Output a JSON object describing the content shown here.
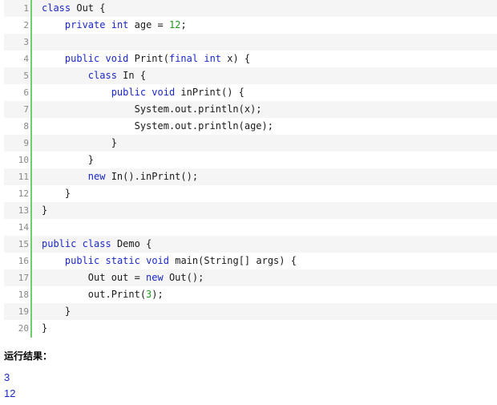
{
  "code": {
    "lines": [
      {
        "num": "1",
        "tokens": [
          {
            "t": "class",
            "k": "kw"
          },
          {
            "t": " Out {",
            "k": "plain"
          }
        ]
      },
      {
        "num": "2",
        "tokens": [
          {
            "t": "    ",
            "k": "plain"
          },
          {
            "t": "private",
            "k": "kw"
          },
          {
            "t": " ",
            "k": "plain"
          },
          {
            "t": "int",
            "k": "kw"
          },
          {
            "t": " age = ",
            "k": "plain"
          },
          {
            "t": "12",
            "k": "num"
          },
          {
            "t": ";",
            "k": "plain"
          }
        ]
      },
      {
        "num": "3",
        "tokens": []
      },
      {
        "num": "4",
        "tokens": [
          {
            "t": "    ",
            "k": "plain"
          },
          {
            "t": "public",
            "k": "kw"
          },
          {
            "t": " ",
            "k": "plain"
          },
          {
            "t": "void",
            "k": "kw"
          },
          {
            "t": " Print(",
            "k": "plain"
          },
          {
            "t": "final",
            "k": "kw"
          },
          {
            "t": " ",
            "k": "plain"
          },
          {
            "t": "int",
            "k": "kw"
          },
          {
            "t": " x) {",
            "k": "plain"
          }
        ]
      },
      {
        "num": "5",
        "tokens": [
          {
            "t": "        ",
            "k": "plain"
          },
          {
            "t": "class",
            "k": "kw"
          },
          {
            "t": " In {",
            "k": "plain"
          }
        ]
      },
      {
        "num": "6",
        "tokens": [
          {
            "t": "            ",
            "k": "plain"
          },
          {
            "t": "public",
            "k": "kw"
          },
          {
            "t": " ",
            "k": "plain"
          },
          {
            "t": "void",
            "k": "kw"
          },
          {
            "t": " inPrint() {",
            "k": "plain"
          }
        ]
      },
      {
        "num": "7",
        "tokens": [
          {
            "t": "                System.out.println(x);",
            "k": "plain"
          }
        ]
      },
      {
        "num": "8",
        "tokens": [
          {
            "t": "                System.out.println(age);",
            "k": "plain"
          }
        ]
      },
      {
        "num": "9",
        "tokens": [
          {
            "t": "            }",
            "k": "plain"
          }
        ]
      },
      {
        "num": "10",
        "tokens": [
          {
            "t": "        }",
            "k": "plain"
          }
        ]
      },
      {
        "num": "11",
        "tokens": [
          {
            "t": "        ",
            "k": "plain"
          },
          {
            "t": "new",
            "k": "kw"
          },
          {
            "t": " In().inPrint();",
            "k": "plain"
          }
        ]
      },
      {
        "num": "12",
        "tokens": [
          {
            "t": "    }",
            "k": "plain"
          }
        ]
      },
      {
        "num": "13",
        "tokens": [
          {
            "t": "}",
            "k": "plain"
          }
        ]
      },
      {
        "num": "14",
        "tokens": []
      },
      {
        "num": "15",
        "tokens": [
          {
            "t": "public",
            "k": "kw"
          },
          {
            "t": " ",
            "k": "plain"
          },
          {
            "t": "class",
            "k": "kw"
          },
          {
            "t": " Demo {",
            "k": "plain"
          }
        ]
      },
      {
        "num": "16",
        "tokens": [
          {
            "t": "    ",
            "k": "plain"
          },
          {
            "t": "public",
            "k": "kw"
          },
          {
            "t": " ",
            "k": "plain"
          },
          {
            "t": "static",
            "k": "kw"
          },
          {
            "t": " ",
            "k": "plain"
          },
          {
            "t": "void",
            "k": "kw"
          },
          {
            "t": " main(String[] args) {",
            "k": "plain"
          }
        ]
      },
      {
        "num": "17",
        "tokens": [
          {
            "t": "        Out out = ",
            "k": "plain"
          },
          {
            "t": "new",
            "k": "kw"
          },
          {
            "t": " Out();",
            "k": "plain"
          }
        ]
      },
      {
        "num": "18",
        "tokens": [
          {
            "t": "        out.Print(",
            "k": "plain"
          },
          {
            "t": "3",
            "k": "num"
          },
          {
            "t": ");",
            "k": "plain"
          }
        ]
      },
      {
        "num": "19",
        "tokens": [
          {
            "t": "    }",
            "k": "plain"
          }
        ]
      },
      {
        "num": "20",
        "tokens": [
          {
            "t": "}",
            "k": "plain"
          }
        ]
      }
    ]
  },
  "result": {
    "label": "运行结果：",
    "outputs": [
      "3",
      "12"
    ]
  },
  "colors": {
    "keyword": "#1a28c8",
    "number": "#1f9a1f",
    "gutter": "#6ccf6c",
    "output": "#1a28c8"
  }
}
